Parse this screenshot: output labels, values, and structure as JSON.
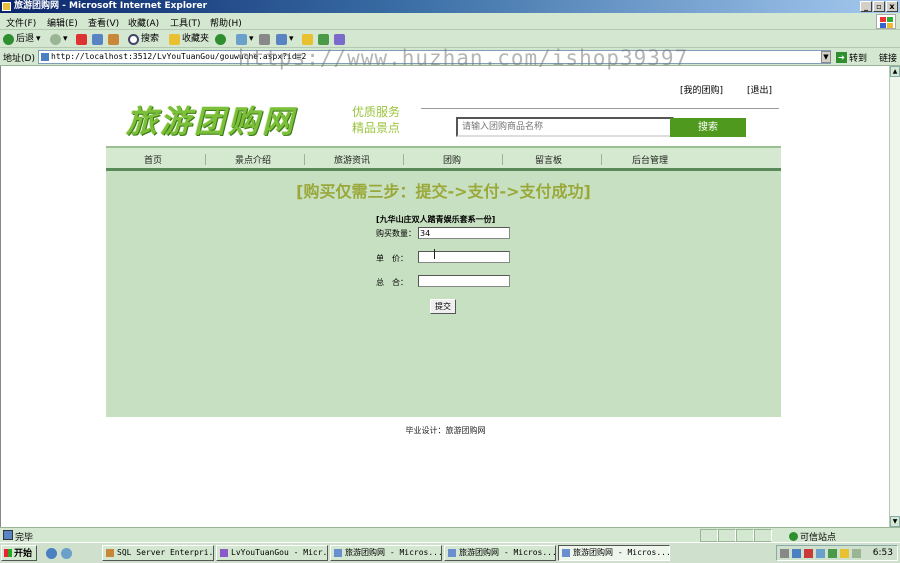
{
  "window": {
    "title": "旅游团购网 - Microsoft Internet Explorer",
    "min": "_",
    "max": "▫",
    "close": "x"
  },
  "menu": [
    "文件(F)",
    "编辑(E)",
    "查看(V)",
    "收藏(A)",
    "工具(T)",
    "帮助(H)"
  ],
  "toolbar": {
    "back": "后退",
    "search": "搜索",
    "favorites": "收藏夹"
  },
  "address": {
    "label": "地址(D)",
    "url": "http://localhost:3512/LvYouTuanGou/gouwuche.aspx?id=2",
    "go": "转到",
    "links": "链接"
  },
  "watermark": "https://www.huzhan.com/ishop39397",
  "site": {
    "my_group": "[我的团购]",
    "logout": "[退出]",
    "logo": "旅游团购网",
    "slogan_line1": "优质服务",
    "slogan_line2": "精品景点",
    "search_placeholder": "请输入团购商品名称",
    "search_button": "搜索",
    "nav": [
      "首页",
      "景点介绍",
      "旅游资讯",
      "团购",
      "留言板",
      "后台管理"
    ]
  },
  "order": {
    "steps_title": "[购买仅需三步：提交->支付->支付成功]",
    "product_title": "[九华山庄双人踏青娱乐套系一份]",
    "quantity_label": "购买数量：",
    "quantity_value": "34",
    "unit_price_label": "单　价：",
    "unit_price_value": "",
    "total_label": "总　合：",
    "total_value": "",
    "submit": "提交"
  },
  "footer": "毕业设计：旅游团购网",
  "status": {
    "text": "完毕",
    "zone": "可信站点"
  },
  "taskbar": {
    "start": "开始",
    "tasks": [
      "SQL Server Enterpri...",
      "LvYouTuanGou - Micr...",
      "旅游团购网 - Micros...",
      "旅游团购网 - Micros...",
      "旅游团购网 - Micros..."
    ],
    "clock": "6:53"
  }
}
